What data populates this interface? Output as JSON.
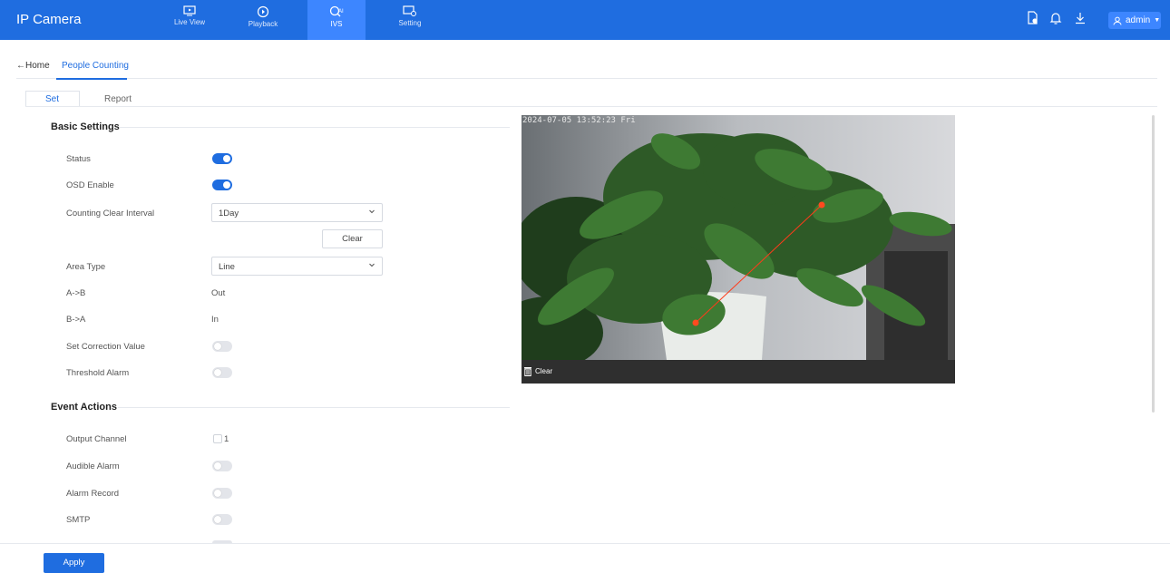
{
  "header": {
    "app_title": "IP Camera",
    "nav": [
      {
        "label": "Live View",
        "icon": "live-view-icon"
      },
      {
        "label": "Playback",
        "icon": "playback-icon"
      },
      {
        "label": "IVS",
        "icon": "ai-icon",
        "active": true
      },
      {
        "label": "Setting",
        "icon": "setting-icon"
      }
    ],
    "user": "admin",
    "accent_color": "#1f6de0"
  },
  "breadcrumb": {
    "home": "Home",
    "current": "People Counting"
  },
  "tabs": [
    "Set",
    "Report"
  ],
  "basic_settings": {
    "title": "Basic Settings",
    "status_label": "Status",
    "status_on": true,
    "osd_label": "OSD Enable",
    "osd_on": true,
    "interval_label": "Counting Clear Interval",
    "interval_value": "1Day",
    "clear_button": "Clear",
    "area_type_label": "Area Type",
    "area_type_value": "Line",
    "ab_label": "A->B",
    "ab_value": "Out",
    "ba_label": "B->A",
    "ba_value": "In",
    "correction_label": "Set Correction Value",
    "correction_on": false,
    "threshold_label": "Threshold Alarm",
    "threshold_on": false
  },
  "event_actions": {
    "title": "Event Actions",
    "output_channel_label": "Output Channel",
    "output_channel_option": "1",
    "audible_label": "Audible Alarm",
    "audible_on": false,
    "record_label": "Alarm Record",
    "record_on": false,
    "smtp_label": "SMTP",
    "smtp_on": false
  },
  "video": {
    "timestamp": "2024-07-05 13:52:23 Fri",
    "clear_label": "Clear"
  },
  "footer": {
    "apply_label": "Apply"
  }
}
